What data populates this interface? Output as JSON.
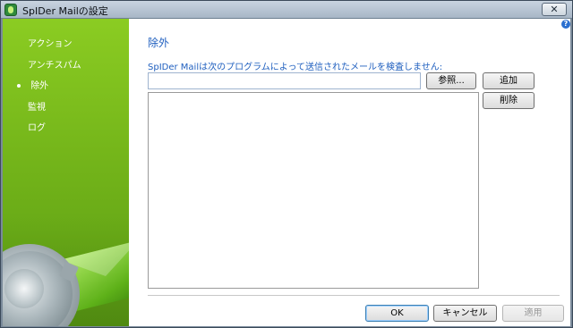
{
  "window": {
    "title": "SpIDer Mailの設定",
    "close_label": "✕"
  },
  "sidebar": {
    "items": [
      {
        "label": "アクション",
        "active": false
      },
      {
        "label": "アンチスパム",
        "active": false
      },
      {
        "label": "除外",
        "active": true
      },
      {
        "label": "監視",
        "active": false
      },
      {
        "label": "ログ",
        "active": false
      }
    ]
  },
  "main": {
    "help": "?",
    "title": "除外",
    "description": "SpIDer Mailは次のプログラムによって送信されたメールを検査しません:",
    "path_input_value": "",
    "browse_label": "参照...",
    "add_label": "追加",
    "delete_label": "削除",
    "exclusion_list": []
  },
  "footer": {
    "ok_label": "OK",
    "cancel_label": "キャンセル",
    "apply_label": "適用"
  },
  "colors": {
    "accent_text": "#1f5fbf",
    "sidebar_green": "#7bbd1c"
  }
}
